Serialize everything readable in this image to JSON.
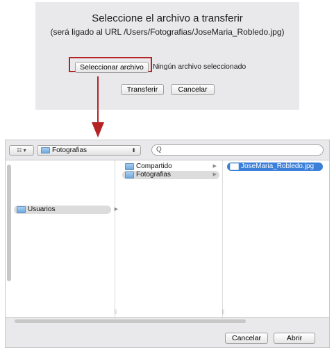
{
  "upload_dialog": {
    "title": "Seleccione el archivo a transferir",
    "subtitle": "(será ligado al URL /Users/Fotografias/JoseMaria_Robledo.jpg)",
    "choose_button": "Seleccionar archivo",
    "no_file_text": "Ningún archivo seleccionado",
    "transfer_button": "Transferir",
    "cancel_button": "Cancelar",
    "highlight_color": "#b52325"
  },
  "file_chooser": {
    "view_button": "☷ ▾",
    "path_folder": "Fotografias",
    "search_glyph": "Q",
    "columns": [
      {
        "items": [
          {
            "label": "Usuarios",
            "selected": "grey",
            "has_children": true
          }
        ]
      },
      {
        "items": [
          {
            "label": "Compartido",
            "selected": "none",
            "has_children": true
          },
          {
            "label": "Fotografias",
            "selected": "grey",
            "has_children": true
          }
        ]
      },
      {
        "items": [
          {
            "label": "JoseMaria_Robledo.jpg",
            "selected": "blue",
            "has_children": false
          }
        ]
      }
    ],
    "cancel_button": "Cancelar",
    "open_button": "Abrir",
    "selection_color": "#3b7fd9"
  }
}
